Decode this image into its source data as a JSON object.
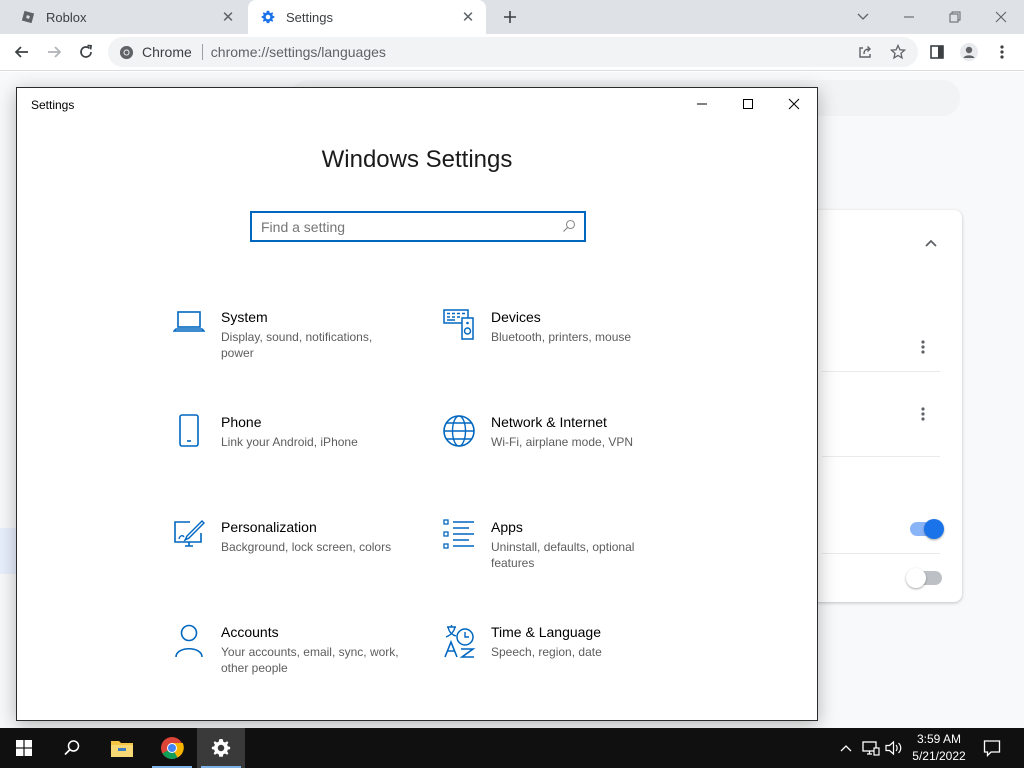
{
  "browser": {
    "tabs": [
      {
        "title": "Roblox",
        "icon": "roblox-icon"
      },
      {
        "title": "Settings",
        "icon": "settings-gear-icon"
      }
    ],
    "omnibox": {
      "site_label": "Chrome",
      "url": "chrome://settings/languages"
    }
  },
  "settings_window": {
    "title": "Settings",
    "heading": "Windows Settings",
    "search_placeholder": "Find a setting",
    "categories": [
      {
        "title": "System",
        "description": "Display, sound, notifications, power",
        "icon": "laptop-icon"
      },
      {
        "title": "Devices",
        "description": "Bluetooth, printers, mouse",
        "icon": "devices-icon"
      },
      {
        "title": "Phone",
        "description": "Link your Android, iPhone",
        "icon": "phone-icon"
      },
      {
        "title": "Network & Internet",
        "description": "Wi-Fi, airplane mode, VPN",
        "icon": "globe-icon"
      },
      {
        "title": "Personalization",
        "description": "Background, lock screen, colors",
        "icon": "personalization-icon"
      },
      {
        "title": "Apps",
        "description": "Uninstall, defaults, optional features",
        "icon": "apps-list-icon"
      },
      {
        "title": "Accounts",
        "description": "Your accounts, email, sync, work, other people",
        "icon": "person-icon"
      },
      {
        "title": "Time & Language",
        "description": "Speech, region, date",
        "icon": "time-language-icon"
      }
    ]
  },
  "taskbar": {
    "time": "3:59 AM",
    "date": "5/21/2022"
  },
  "colors": {
    "accent": "#0067c0",
    "chrome_toggle_on": "#1a73e8",
    "taskbar": "#101010"
  }
}
